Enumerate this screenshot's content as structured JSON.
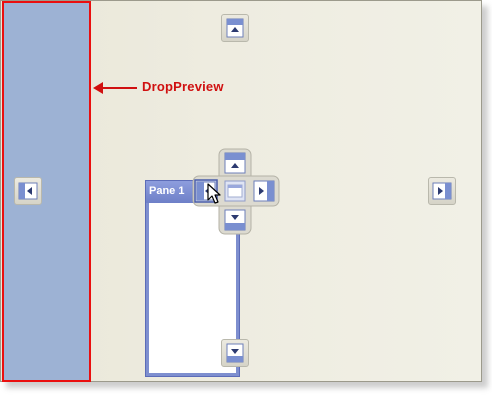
{
  "callout": {
    "label": "DropPreview",
    "color": "#d01010"
  },
  "pane": {
    "title": "Pane 1"
  },
  "colors": {
    "drop_preview_fill": "#9db2d4",
    "drop_preview_border": "#ea0f0f",
    "pane_border": "#7e8fcf",
    "dock_background": "#eeece0"
  },
  "guides": {
    "outer": [
      "dock-top",
      "dock-left",
      "dock-right",
      "dock-bottom"
    ],
    "compass": [
      "compass-top",
      "compass-left",
      "compass-center",
      "compass-right",
      "compass-bottom"
    ]
  },
  "cursor": {
    "icon": "arrow-cursor-icon"
  }
}
